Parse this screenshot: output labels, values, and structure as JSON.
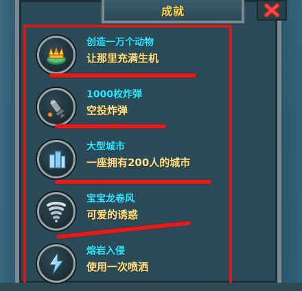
{
  "panel": {
    "title": "成就",
    "close_icon": "close-x-icon",
    "accent": "#ffd45a",
    "highlight": "#d31d1d"
  },
  "achievements": [
    {
      "title": "创造一万个动物",
      "description": "让那里充满生机",
      "icon": "animal-crown-icon"
    },
    {
      "title": "1000枚炸弹",
      "description": "空投炸弹",
      "icon": "bomb-icon"
    },
    {
      "title": "大型城市",
      "description": "一座拥有200人的城市",
      "icon": "city-building-icon"
    },
    {
      "title": "宝宝龙卷风",
      "description": "可爱的诱惑",
      "icon": "tornado-icon"
    },
    {
      "title": "熔岩入侵",
      "description": "使用一次喷洒",
      "icon": "lightning-icon"
    }
  ]
}
